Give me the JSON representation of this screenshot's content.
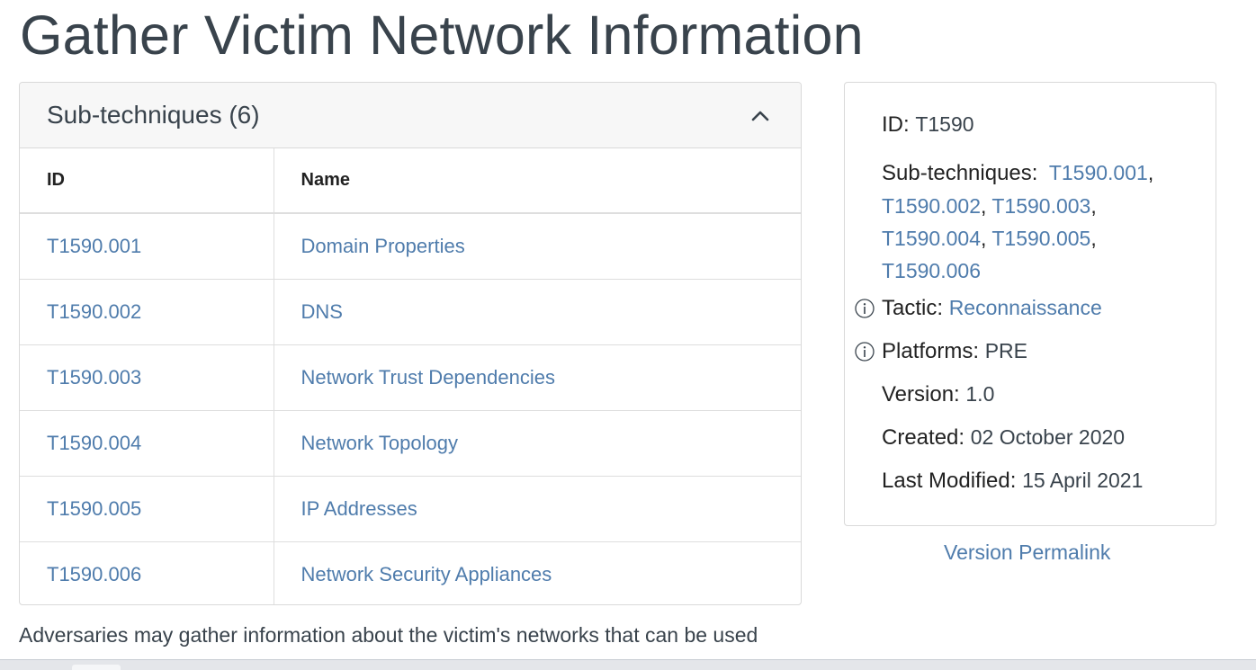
{
  "page": {
    "title": "Gather Victim Network Information",
    "description": "Adversaries may gather information about the victim's networks that can be used"
  },
  "subtechniques": {
    "header": "Sub-techniques (6)",
    "columns": [
      "ID",
      "Name"
    ],
    "rows": [
      {
        "id": "T1590.001",
        "name": "Domain Properties"
      },
      {
        "id": "T1590.002",
        "name": "DNS"
      },
      {
        "id": "T1590.003",
        "name": "Network Trust Dependencies"
      },
      {
        "id": "T1590.004",
        "name": "Network Topology"
      },
      {
        "id": "T1590.005",
        "name": "IP Addresses"
      },
      {
        "id": "T1590.006",
        "name": "Network Security Appliances"
      }
    ]
  },
  "info": {
    "id_label": "ID:",
    "id_value": "T1590",
    "subtech_label": "Sub-techniques:",
    "subtech_links": [
      "T1590.001",
      "T1590.002",
      "T1590.003",
      "T1590.004",
      "T1590.005",
      "T1590.006"
    ],
    "tactic_label": "Tactic:",
    "tactic_value": "Reconnaissance",
    "platforms_label": "Platforms:",
    "platforms_value": "PRE",
    "version_label": "Version:",
    "version_value": "1.0",
    "created_label": "Created:",
    "created_value": "02 October 2020",
    "modified_label": "Last Modified:",
    "modified_value": "15 April 2021"
  },
  "permalink_label": "Version Permalink",
  "icons": {
    "collapse": "chevron-up-icon",
    "info": "info-circle-icon"
  },
  "colors": {
    "link": "#4f7cac",
    "text": "#39434c",
    "border": "#d9d9d9"
  }
}
